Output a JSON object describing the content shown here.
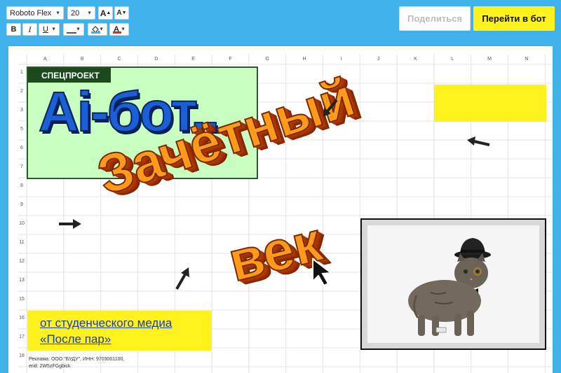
{
  "toolbar": {
    "font_family_value": "Roboto Flex",
    "font_size_value": "20",
    "font_size_increase_label": "A",
    "font_size_decrease_label": "A",
    "bold_label": "B",
    "italic_label": "I",
    "underline_label": "U",
    "text_color_label": "A"
  },
  "actions": {
    "share_label": "Поделиться",
    "go_to_bot_label": "Перейти в бот"
  },
  "sheet": {
    "columns": [
      "A",
      "B",
      "C",
      "D",
      "E",
      "F",
      "G",
      "H",
      "I",
      "J",
      "K",
      "L",
      "M",
      "N"
    ],
    "rows": [
      "1",
      "2",
      "3",
      "5",
      "6",
      "7",
      "8",
      "9",
      "10",
      "11",
      "12",
      "13",
      "15",
      "16",
      "17",
      "18"
    ]
  },
  "promo": {
    "badge": "СПЕЦПРОЕКТ",
    "title": "Ai-бот..",
    "headline_line1": "Зачётный",
    "headline_line2": "век",
    "subtitle_line1": "от студенческого медиа",
    "subtitle_line2": "«После пар»",
    "ad_line1": "Реклама: ООО \"БУДУ\", ИНН: 9703001100,",
    "ad_line2": "erid: 2W5zFGgbick"
  },
  "colors": {
    "background": "#3fb2ec",
    "accent_yellow": "#fff21c",
    "title_blue": "#1a5fd6",
    "headline_orange": "#ff9a1a",
    "badge_green": "#1d4a1d"
  }
}
